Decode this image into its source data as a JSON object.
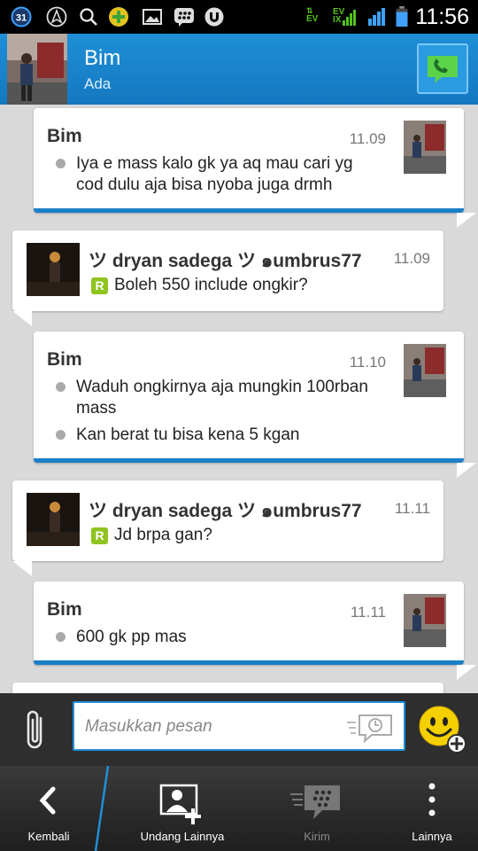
{
  "status_bar": {
    "clock": "11:56",
    "calendar_day": "31",
    "net1": "EV",
    "net2_top": "EV",
    "net2_bottom": "IX"
  },
  "header": {
    "contact_name": "Bim",
    "contact_status": "Ada"
  },
  "messages": [
    {
      "sender": "Bim",
      "time": "11.09",
      "side": "right",
      "lines": [
        "Iya e mass kalo gk ya aq mau cari yg",
        "cod dulu aja bisa nyoba juga drmh"
      ]
    },
    {
      "sender": "ツ dryan sadega ツ ๑umbrus77",
      "time": "11.09",
      "side": "left",
      "lines": [
        "Boleh 550 include ongkir?"
      ]
    },
    {
      "sender": "Bim",
      "time": "11.10",
      "side": "right",
      "lines": [
        "Waduh ongkirnya aja mungkin 100rban",
        "mass",
        "Kan berat tu bisa kena 5 kgan"
      ]
    },
    {
      "sender": "ツ dryan sadega ツ ๑umbrus77",
      "time": "11.11",
      "side": "left",
      "lines": [
        "Jd brpa gan?"
      ]
    },
    {
      "sender": "Bim",
      "time": "11.11",
      "side": "right",
      "lines": [
        "600 gk pp mas"
      ]
    }
  ],
  "read_badge": "R",
  "compose": {
    "placeholder": "Masukkan pesan"
  },
  "bottom_nav": {
    "back": "Kembali",
    "invite": "Undang Lainnya",
    "send": "Kirim",
    "more": "Lainnya"
  },
  "colors": {
    "accent": "#1e8fd8",
    "call_green": "#5cd34a",
    "read_green": "#8fc31f"
  }
}
